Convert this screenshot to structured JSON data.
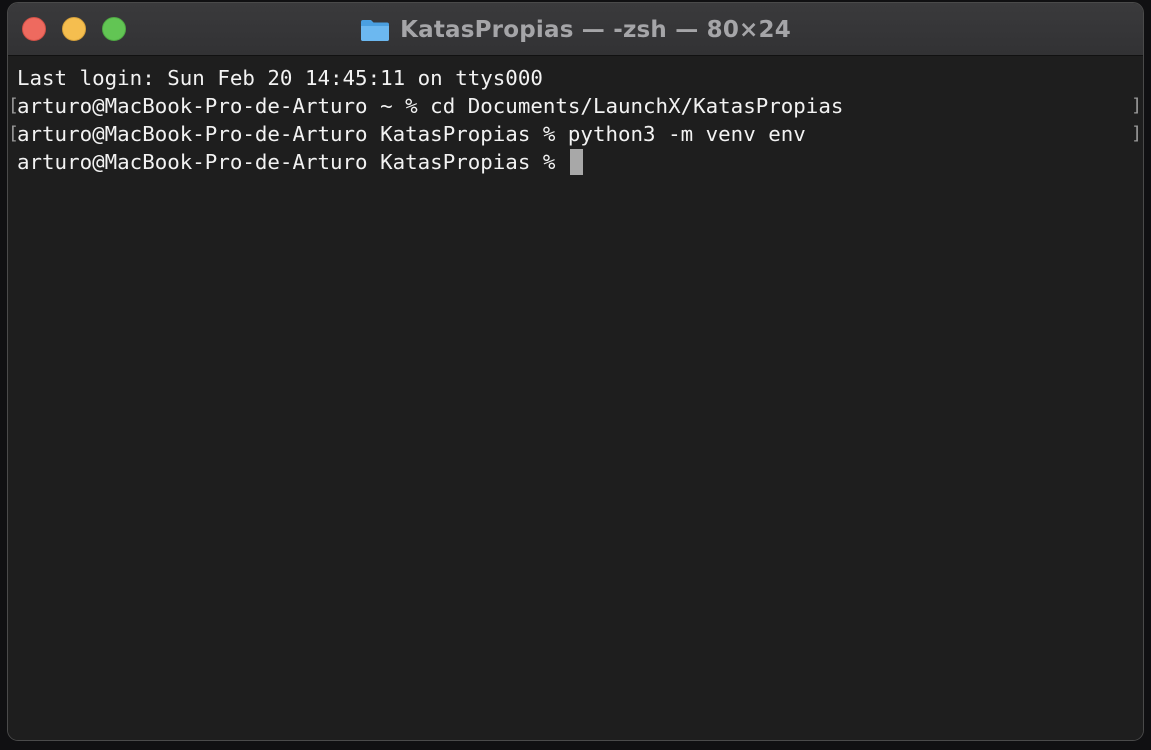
{
  "window": {
    "title": "KatasPropias — -zsh — 80×24",
    "folder_icon": "folder-icon",
    "controls": [
      "close",
      "minimize",
      "zoom"
    ]
  },
  "terminal": {
    "lines": [
      "Last login: Sun Feb 20 14:45:11 on ttys000",
      "arturo@MacBook-Pro-de-Arturo ~ % cd Documents/LaunchX/KatasPropias",
      "arturo@MacBook-Pro-de-Arturo KatasPropias % python3 -m venv env",
      "arturo@MacBook-Pro-de-Arturo KatasPropias % "
    ],
    "left_mark": "[",
    "right_mark": "]"
  },
  "colors": {
    "background": "#1e1e1e",
    "text": "#f2f2f2",
    "cursor": "#a8a8a8",
    "titlebar": "#353537"
  }
}
